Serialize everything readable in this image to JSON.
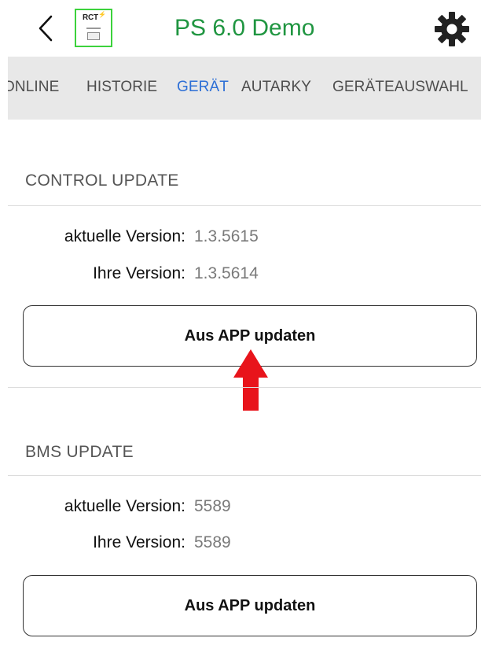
{
  "header": {
    "title": "PS 6.0 Demo",
    "logo_text": "RCT",
    "logo_mark": "⚡",
    "back_icon": "chevron-left",
    "settings_icon": "gear"
  },
  "tabs": [
    {
      "label": "ONLINE",
      "active": false
    },
    {
      "label": "HISTORIE",
      "active": false
    },
    {
      "label": "GERÄT",
      "active": true
    },
    {
      "label": "AUTARKY",
      "active": false
    },
    {
      "label": "GERÄTEAUSWAHL",
      "active": false
    }
  ],
  "control_update": {
    "title": "CONTROL UPDATE",
    "current_label": "aktuelle Version:",
    "current_value": "1.3.5615",
    "yours_label": "Ihre Version:",
    "yours_value": "1.3.5614",
    "button_label": "Aus APP updaten"
  },
  "bms_update": {
    "title": "BMS UPDATE",
    "current_label": "aktuelle Version:",
    "current_value": "5589",
    "yours_label": "Ihre Version:",
    "yours_value": "5589",
    "button_label": "Aus APP updaten"
  },
  "colors": {
    "title_green": "#1f9540",
    "tab_active": "#2d6fd6",
    "tab_bar_bg": "#e8e8e8",
    "logo_border": "#3cd23c",
    "arrow_red": "#e8141b"
  }
}
